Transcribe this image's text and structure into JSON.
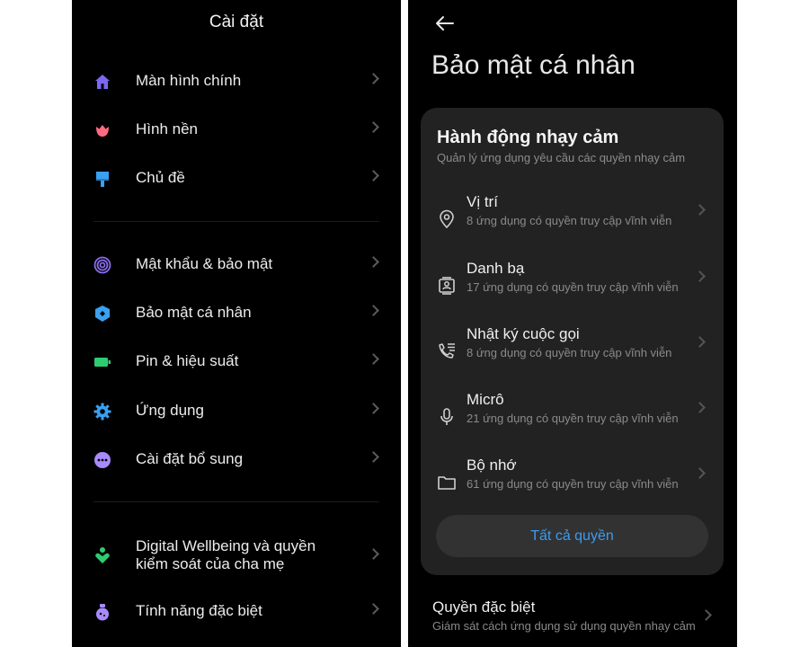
{
  "colors": {
    "background": "#000000",
    "card": "#222222",
    "accent_link": "#3d9bf0",
    "home_icon": "#7b68ee",
    "wallpaper_icon": "#ff6b81",
    "theme_icon": "#3aa0f0",
    "password_icon": "#8a6cf0",
    "privacy_icon": "#3aa0f0",
    "battery_icon": "#2ecc71",
    "apps_icon": "#3aa0f0",
    "more_icon": "#a78bfa",
    "wellbeing_icon": "#2ecc71",
    "special_icon": "#a78bfa"
  },
  "left": {
    "title": "Cài đặt",
    "items": [
      {
        "label": "Màn hình chính",
        "icon": "home-icon"
      },
      {
        "label": "Hình nền",
        "icon": "flower-icon"
      },
      {
        "label": "Chủ đề",
        "icon": "paintbrush-icon"
      },
      {
        "label": "Mật khẩu & bảo mật",
        "icon": "fingerprint-icon"
      },
      {
        "label": "Bảo mật cá nhân",
        "icon": "shield-icon"
      },
      {
        "label": "Pin & hiệu suất",
        "icon": "battery-icon"
      },
      {
        "label": "Ứng dụng",
        "icon": "gear-icon"
      },
      {
        "label": "Cài đặt bổ sung",
        "icon": "more-dots-icon"
      },
      {
        "label": "Digital Wellbeing và quyền\nkiểm soát của cha mẹ",
        "icon": "wellbeing-icon"
      },
      {
        "label": "Tính năng đặc biệt",
        "icon": "potion-icon"
      }
    ]
  },
  "right": {
    "title": "Bảo mật cá nhân",
    "card": {
      "title": "Hành động nhạy cảm",
      "subtitle": "Quản lý ứng dụng yêu cầu các quyền nhạy cảm",
      "permissions": [
        {
          "name": "Vị trí",
          "desc": "8 ứng dụng có quyền truy cập vĩnh viễn",
          "icon": "location-pin-icon"
        },
        {
          "name": "Danh bạ",
          "desc": "17 ứng dụng có quyền truy cập vĩnh viễn",
          "icon": "contacts-icon"
        },
        {
          "name": "Nhật ký cuộc gọi",
          "desc": "8 ứng dụng có quyền truy cập vĩnh viễn",
          "icon": "call-log-icon"
        },
        {
          "name": "Micrô",
          "desc": "21 ứng dụng có quyền truy cập vĩnh viễn",
          "icon": "microphone-icon"
        },
        {
          "name": "Bộ nhớ",
          "desc": "61 ứng dụng có quyền truy cập vĩnh viễn",
          "icon": "folder-icon"
        }
      ],
      "all_button": "Tất cả quyền"
    },
    "special": {
      "name": "Quyền đặc biệt",
      "desc": "Giám sát cách ứng dụng sử dụng quyền nhạy cảm"
    }
  }
}
